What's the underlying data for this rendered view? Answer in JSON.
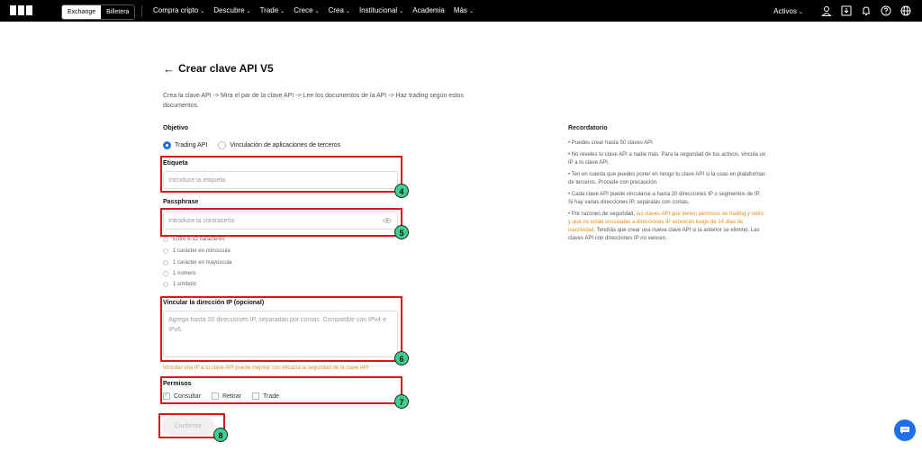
{
  "header": {
    "toggle_exchange": "Exchange",
    "toggle_wallet": "Billetera",
    "nav": [
      "Compra cripto",
      "Descubre",
      "Trade",
      "Crece",
      "Crea",
      "Institucional",
      "Academia",
      "Más"
    ],
    "nav_dropdown": [
      true,
      true,
      true,
      true,
      true,
      true,
      false,
      true
    ],
    "assets_label": "Activos"
  },
  "page": {
    "back_arrow": "←",
    "title": "Crear clave API V5",
    "description": "Crea la clave API -> Mira el par de la clave API -> Lee los documentos de la API -> Haz trading según estos documentos."
  },
  "form": {
    "objective_label": "Objetivo",
    "objective_options": [
      "Trading API",
      "Vinculación de aplicaciones de terceros"
    ],
    "objective_selected": "Trading API",
    "tag_label": "Etiqueta",
    "tag_placeholder": "Introduce la etiqueta",
    "passphrase_label": "Passphrase",
    "passphrase_placeholder": "Introduce la contraseña",
    "requirements": [
      "Entre 8-32 caracteres",
      "1 carácter en minúscula",
      "1 carácter en mayúscula",
      "1 número",
      "1 símbolo"
    ],
    "ip_label": "Vincular la dirección IP (opcional)",
    "ip_placeholder": "Agrega hasta 20 direcciones IP, separadas por comas. Compatible con IPv4 e IPv6.",
    "ip_warning": "Vincular una IP a tu clave API puede mejorar con eficacia la seguridad de la clave API",
    "permissions_label": "Permisos",
    "permissions": [
      {
        "label": "Consultar",
        "checked": true
      },
      {
        "label": "Retirar",
        "checked": false
      },
      {
        "label": "Trade",
        "checked": false
      }
    ],
    "confirm_label": "Confirmar"
  },
  "annotations": [
    "4",
    "5",
    "6",
    "7",
    "8"
  ],
  "reminder": {
    "title": "Recordatorio",
    "item1": "• Puedes crear hasta 50 claves API",
    "item2": "• No reveles tu clave API a nadie más. Para la seguridad de tus activos, vincula un IP a tu clave API.",
    "item3": "• Ten en cuenta que puedes poner en riesgo tu clave API si la usas en plataformas de terceros. Procede con precaución.",
    "item4": "• Cada clave API puede vincularse a hasta 20 direcciones IP o segmentos de IP. Si hay varias direcciones IP, sepáralas con comas.",
    "item5_a": "• Por razones de seguridad, ",
    "item5_b": "las claves API que tienen permisos de trading y retiro y que no están vinculadas a direcciones IP vencerán luego de 14 días de inactividad.",
    "item5_c": " Tendrás que crear una nueva clave API si la anterior se eliminó. Las claves API con direcciones IP no vencen."
  },
  "colors": {
    "accent": "#1f6fea",
    "highlight_border": "#d7191c",
    "badge": "#3ecf8e",
    "warning": "#e38b1c"
  }
}
